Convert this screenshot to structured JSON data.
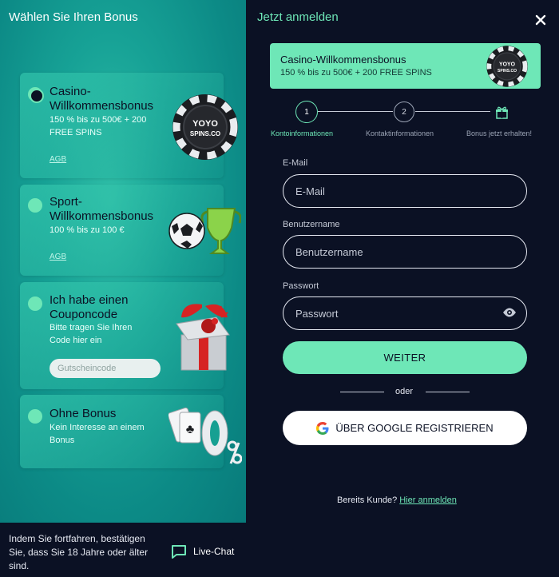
{
  "left": {
    "title": "Wählen Sie Ihren Bonus",
    "cards": [
      {
        "title": "Casino-\nWillkommensbonus",
        "desc": "150 % bis zu 500€ + 200\nFREE SPINS",
        "link": "AGB",
        "selected": true
      },
      {
        "title": "Sport-\nWillkommensbonus",
        "desc": "100 % bis zu 100 €",
        "link": "AGB",
        "selected": false
      },
      {
        "title": "Ich habe einen\nCouponcode",
        "desc": "Bitte tragen Sie Ihren\nCode hier ein",
        "input_placeholder": "Gutscheincode",
        "selected": false
      },
      {
        "title": "Ohne Bonus",
        "desc": "Kein Interesse an einem\nBonus",
        "selected": false
      }
    ],
    "chip_logo": {
      "line1": "YOYO",
      "line2": "SPINS.CO"
    },
    "footer_note": "Indem Sie fortfahren, bestätigen Sie, dass Sie 18 Jahre oder älter sind.",
    "chat_label": "Live-Chat"
  },
  "right": {
    "title": "Jetzt anmelden",
    "promo": {
      "title": "Casino-Willkommensbonus",
      "subtitle": "150 % bis zu 500€ + 200 FREE SPINS"
    },
    "steps": [
      {
        "number": "1",
        "label": "Kontoinformationen",
        "active": true
      },
      {
        "number": "2",
        "label": "Kontaktinformationen",
        "active": false
      },
      {
        "icon": "gift-icon",
        "label": "Bonus jetzt erhalten!",
        "active": false
      }
    ],
    "fields": {
      "email": {
        "label": "E-Mail",
        "placeholder": "E-Mail"
      },
      "username": {
        "label": "Benutzername",
        "placeholder": "Benutzername"
      },
      "password": {
        "label": "Passwort",
        "placeholder": "Passwort"
      }
    },
    "continue_label": "WEITER",
    "or_label": "oder",
    "google_label": "ÜBER GOOGLE REGISTRIEREN",
    "already_text": "Bereits Kunde?",
    "login_link": "Hier anmelden"
  },
  "colors": {
    "accent": "#6ee7b7",
    "dark_bg": "#0b1124",
    "teal": "#17a296"
  }
}
